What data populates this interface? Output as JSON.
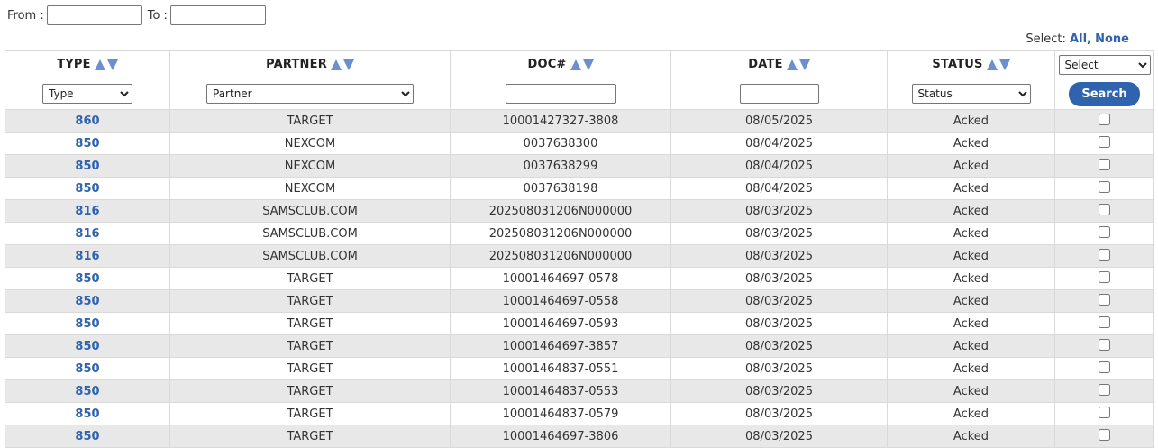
{
  "date_range": {
    "from_label": "From :",
    "to_label": "To :",
    "from_value": "",
    "to_value": ""
  },
  "select_links": {
    "prefix": "Select:",
    "all": "All,",
    "none": "None"
  },
  "columns": {
    "type": "TYPE",
    "partner": "PARTNER",
    "doc": "DOC#",
    "date": "DATE",
    "status": "STATUS"
  },
  "filters": {
    "type_selected": "Type",
    "partner_selected": "Partner",
    "doc_value": "",
    "date_value": "",
    "status_selected": "Status",
    "action_selected": "Select",
    "search_label": "Search"
  },
  "rows": [
    {
      "type": "860",
      "partner": "TARGET",
      "doc": "10001427327-3808",
      "date": "08/05/2025",
      "status": "Acked"
    },
    {
      "type": "850",
      "partner": "NEXCOM",
      "doc": "0037638300",
      "date": "08/04/2025",
      "status": "Acked"
    },
    {
      "type": "850",
      "partner": "NEXCOM",
      "doc": "0037638299",
      "date": "08/04/2025",
      "status": "Acked"
    },
    {
      "type": "850",
      "partner": "NEXCOM",
      "doc": "0037638198",
      "date": "08/04/2025",
      "status": "Acked"
    },
    {
      "type": "816",
      "partner": "SAMSCLUB.COM",
      "doc": "202508031206N000000",
      "date": "08/03/2025",
      "status": "Acked"
    },
    {
      "type": "816",
      "partner": "SAMSCLUB.COM",
      "doc": "202508031206N000000",
      "date": "08/03/2025",
      "status": "Acked"
    },
    {
      "type": "816",
      "partner": "SAMSCLUB.COM",
      "doc": "202508031206N000000",
      "date": "08/03/2025",
      "status": "Acked"
    },
    {
      "type": "850",
      "partner": "TARGET",
      "doc": "10001464697-0578",
      "date": "08/03/2025",
      "status": "Acked"
    },
    {
      "type": "850",
      "partner": "TARGET",
      "doc": "10001464697-0558",
      "date": "08/03/2025",
      "status": "Acked"
    },
    {
      "type": "850",
      "partner": "TARGET",
      "doc": "10001464697-0593",
      "date": "08/03/2025",
      "status": "Acked"
    },
    {
      "type": "850",
      "partner": "TARGET",
      "doc": "10001464697-3857",
      "date": "08/03/2025",
      "status": "Acked"
    },
    {
      "type": "850",
      "partner": "TARGET",
      "doc": "10001464837-0551",
      "date": "08/03/2025",
      "status": "Acked"
    },
    {
      "type": "850",
      "partner": "TARGET",
      "doc": "10001464837-0553",
      "date": "08/03/2025",
      "status": "Acked"
    },
    {
      "type": "850",
      "partner": "TARGET",
      "doc": "10001464837-0579",
      "date": "08/03/2025",
      "status": "Acked"
    },
    {
      "type": "850",
      "partner": "TARGET",
      "doc": "10001464697-3806",
      "date": "08/03/2025",
      "status": "Acked"
    }
  ],
  "colors": {
    "link": "#2f63ae",
    "sort_arrow": "#6b8fcf",
    "stripe": "#e8e8e8",
    "search_button": "#2f63ae"
  },
  "icons": {
    "sort_up": "triangle-up",
    "sort_down": "triangle-down"
  }
}
